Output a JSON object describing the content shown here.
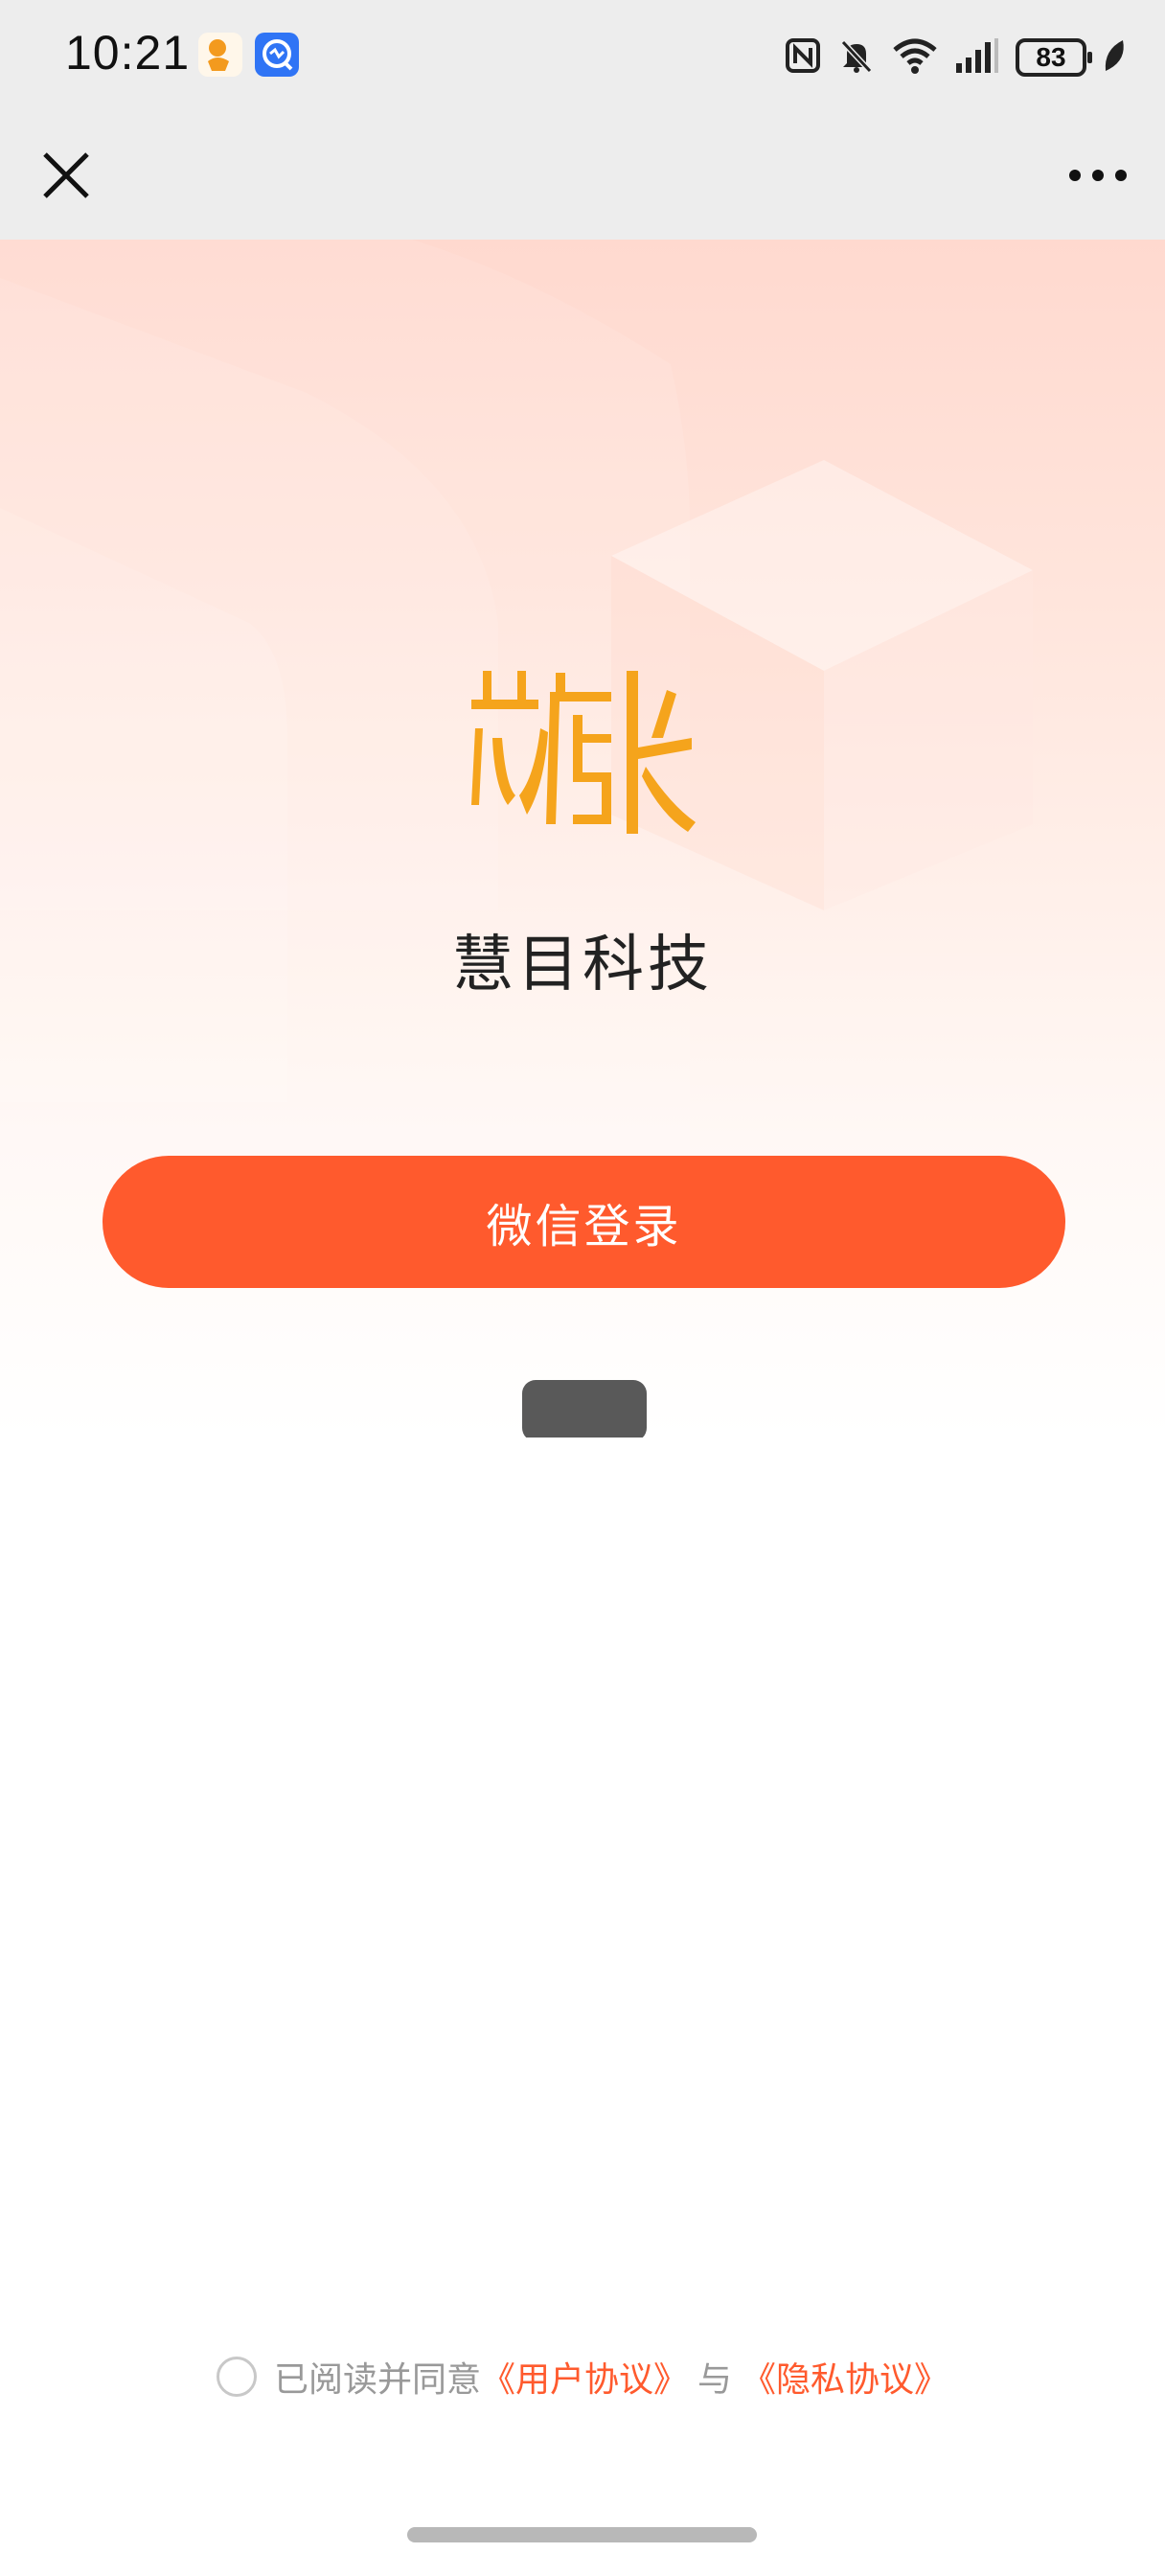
{
  "status_bar": {
    "time": "10:21",
    "battery_level": "83",
    "icons": [
      "app-notification-icon",
      "app-notification-icon",
      "nfc-icon",
      "mute-icon",
      "wifi-icon",
      "cellular-signal-icon",
      "battery-icon",
      "leaf-icon"
    ]
  },
  "navbar": {
    "close_icon": "close-icon",
    "more_icon": "more-icon"
  },
  "hero": {
    "logo_text": "芯店长",
    "brand_name": "慧目科技",
    "login_button": "微信登录"
  },
  "agreement": {
    "prefix": "已阅读并同意",
    "user_agreement": "《用户协议》",
    "conjunction": "与",
    "privacy_agreement": "《隐私协议》"
  },
  "colors": {
    "accent": "#ff5a2d",
    "logo": "#f5a41c",
    "bar_bg": "#ededed"
  }
}
